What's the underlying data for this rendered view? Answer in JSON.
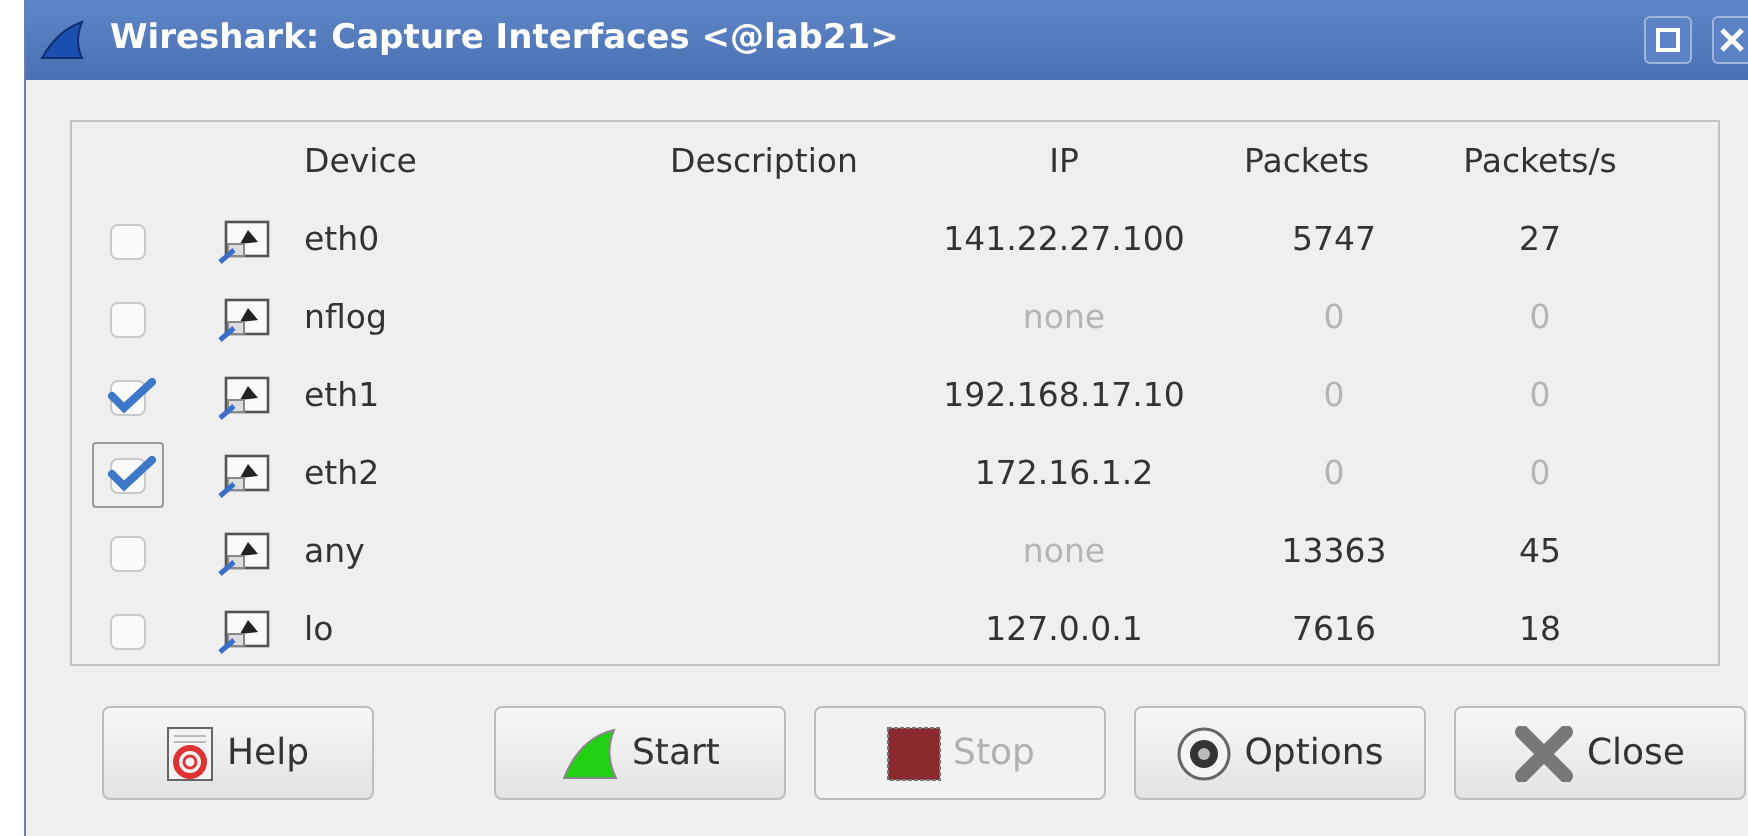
{
  "window": {
    "title": "Wireshark: Capture Interfaces <@lab21>"
  },
  "table": {
    "columns": [
      "Device",
      "Description",
      "IP",
      "Packets",
      "Packets/s"
    ],
    "rows": [
      {
        "checked": false,
        "focused": false,
        "device": "eth0",
        "ip": {
          "text": "141.22.27.100",
          "dimmed": false
        },
        "packets": {
          "text": "5747",
          "dimmed": false
        },
        "rate": {
          "text": "27",
          "dimmed": false
        }
      },
      {
        "checked": false,
        "focused": false,
        "device": "nflog",
        "ip": {
          "text": "none",
          "dimmed": true
        },
        "packets": {
          "text": "0",
          "dimmed": true
        },
        "rate": {
          "text": "0",
          "dimmed": true
        }
      },
      {
        "checked": true,
        "focused": false,
        "device": "eth1",
        "ip": {
          "text": "192.168.17.10",
          "dimmed": false
        },
        "packets": {
          "text": "0",
          "dimmed": true
        },
        "rate": {
          "text": "0",
          "dimmed": true
        }
      },
      {
        "checked": true,
        "focused": true,
        "device": "eth2",
        "ip": {
          "text": "172.16.1.2",
          "dimmed": false
        },
        "packets": {
          "text": "0",
          "dimmed": true
        },
        "rate": {
          "text": "0",
          "dimmed": true
        }
      },
      {
        "checked": false,
        "focused": false,
        "device": "any",
        "ip": {
          "text": "none",
          "dimmed": true
        },
        "packets": {
          "text": "13363",
          "dimmed": false
        },
        "rate": {
          "text": "45",
          "dimmed": false
        }
      },
      {
        "checked": false,
        "focused": false,
        "device": "lo",
        "ip": {
          "text": "127.0.0.1",
          "dimmed": false
        },
        "packets": {
          "text": "7616",
          "dimmed": false
        },
        "rate": {
          "text": "18",
          "dimmed": false
        }
      }
    ]
  },
  "buttons": [
    {
      "kind": "help",
      "label": "Help",
      "disabled": false
    },
    {
      "kind": "start",
      "label": "Start",
      "disabled": false
    },
    {
      "kind": "stop",
      "label": "Stop",
      "disabled": true
    },
    {
      "kind": "options",
      "label": "Options",
      "disabled": false
    },
    {
      "kind": "close",
      "label": "Close",
      "disabled": false
    }
  ]
}
